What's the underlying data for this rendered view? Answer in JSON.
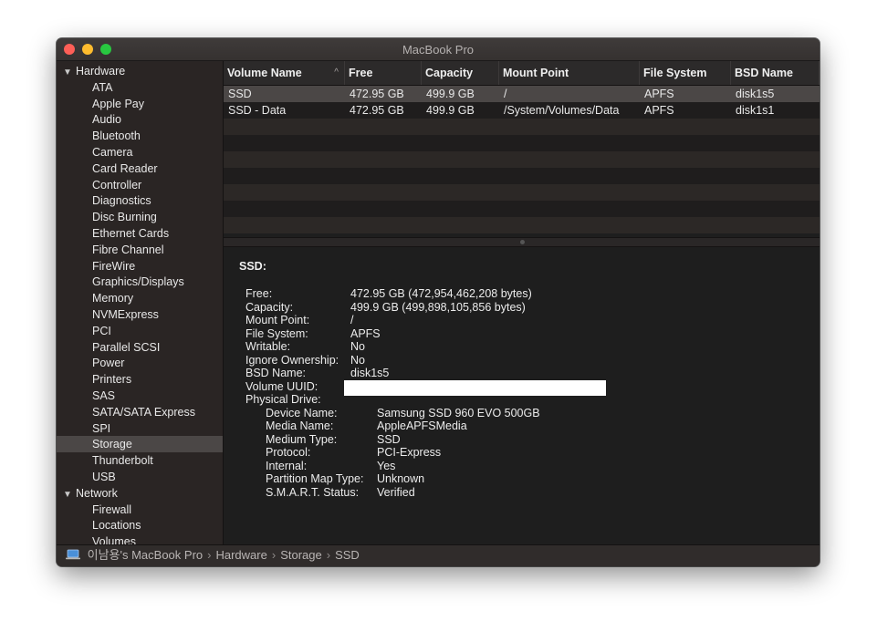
{
  "window": {
    "title": "MacBook Pro"
  },
  "sidebar": {
    "sections": [
      {
        "label": "Hardware",
        "items": [
          "ATA",
          "Apple Pay",
          "Audio",
          "Bluetooth",
          "Camera",
          "Card Reader",
          "Controller",
          "Diagnostics",
          "Disc Burning",
          "Ethernet Cards",
          "Fibre Channel",
          "FireWire",
          "Graphics/Displays",
          "Memory",
          "NVMExpress",
          "PCI",
          "Parallel SCSI",
          "Power",
          "Printers",
          "SAS",
          "SATA/SATA Express",
          "SPI",
          "Storage",
          "Thunderbolt",
          "USB"
        ]
      },
      {
        "label": "Network",
        "items": [
          "Firewall",
          "Locations",
          "Volumes"
        ]
      }
    ],
    "selected": "Storage"
  },
  "table": {
    "columns": [
      "Volume Name",
      "Free",
      "Capacity",
      "Mount Point",
      "File System",
      "BSD Name"
    ],
    "rows": [
      [
        "SSD",
        "472.95 GB",
        "499.9 GB",
        "/",
        "APFS",
        "disk1s5"
      ],
      [
        "SSD - Data",
        "472.95 GB",
        "499.9 GB",
        "/System/Volumes/Data",
        "APFS",
        "disk1s1"
      ]
    ]
  },
  "detail": {
    "heading": "SSD:",
    "fields": [
      [
        "Free:",
        "472.95 GB (472,954,462,208 bytes)"
      ],
      [
        "Capacity:",
        "499.9 GB (499,898,105,856 bytes)"
      ],
      [
        "Mount Point:",
        "/"
      ],
      [
        "File System:",
        "APFS"
      ],
      [
        "Writable:",
        "No"
      ],
      [
        "Ignore Ownership:",
        "No"
      ],
      [
        "BSD Name:",
        "disk1s5"
      ],
      [
        "Volume UUID:",
        ""
      ],
      [
        "Physical Drive:",
        ""
      ]
    ],
    "physical_drive": [
      [
        "Device Name:",
        "Samsung SSD 960 EVO 500GB"
      ],
      [
        "Media Name:",
        "AppleAPFSMedia"
      ],
      [
        "Medium Type:",
        "SSD"
      ],
      [
        "Protocol:",
        "PCI-Express"
      ],
      [
        "Internal:",
        "Yes"
      ],
      [
        "Partition Map Type:",
        "Unknown"
      ],
      [
        "S.M.A.R.T. Status:",
        "Verified"
      ]
    ]
  },
  "statusbar": {
    "path": [
      "이남용's MacBook Pro",
      "Hardware",
      "Storage",
      "SSD"
    ],
    "separator": "›"
  },
  "colors": {
    "close": "#fe5f57",
    "minimize": "#febc2e",
    "zoom": "#28c840",
    "selection": "#4b4746"
  },
  "icons": {
    "sort": "sort-ascending-icon",
    "disclosure": "disclosure-triangle-icon",
    "computer": "laptop-icon"
  }
}
